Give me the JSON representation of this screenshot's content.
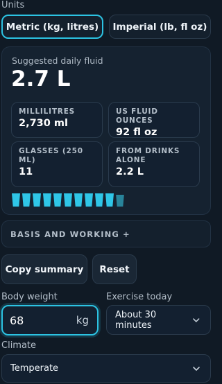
{
  "units": {
    "label": "Units",
    "options": [
      {
        "label": "Metric (kg, litres)",
        "selected": true
      },
      {
        "label": "Imperial (lb, fl oz)",
        "selected": false
      }
    ]
  },
  "result": {
    "suggested_label": "Suggested daily fluid",
    "total": "2.7 L",
    "stats": [
      {
        "label": "MILLILITRES",
        "value": "2,730 ml"
      },
      {
        "label": "US FLUID OUNCES",
        "value": "92 fl oz"
      },
      {
        "label": "GLASSES (250 ML)",
        "value": "11"
      },
      {
        "label": "FROM DRINKS ALONE",
        "value": "2.2 L"
      }
    ],
    "glasses_full": 10,
    "glasses_partial_fill": 0.9
  },
  "basis": {
    "label": "BASIS AND WORKING +"
  },
  "actions": {
    "copy_label": "Copy summary",
    "reset_label": "Reset"
  },
  "inputs": {
    "body_weight_label": "Body weight",
    "body_weight_value": "68",
    "body_weight_unit": "kg",
    "exercise_label": "Exercise today",
    "exercise_value": "About 30 minutes",
    "climate_label": "Climate",
    "climate_value": "Temperate"
  },
  "colors": {
    "accent": "#2cc3e3",
    "background": "#101a25",
    "card": "#152230"
  }
}
